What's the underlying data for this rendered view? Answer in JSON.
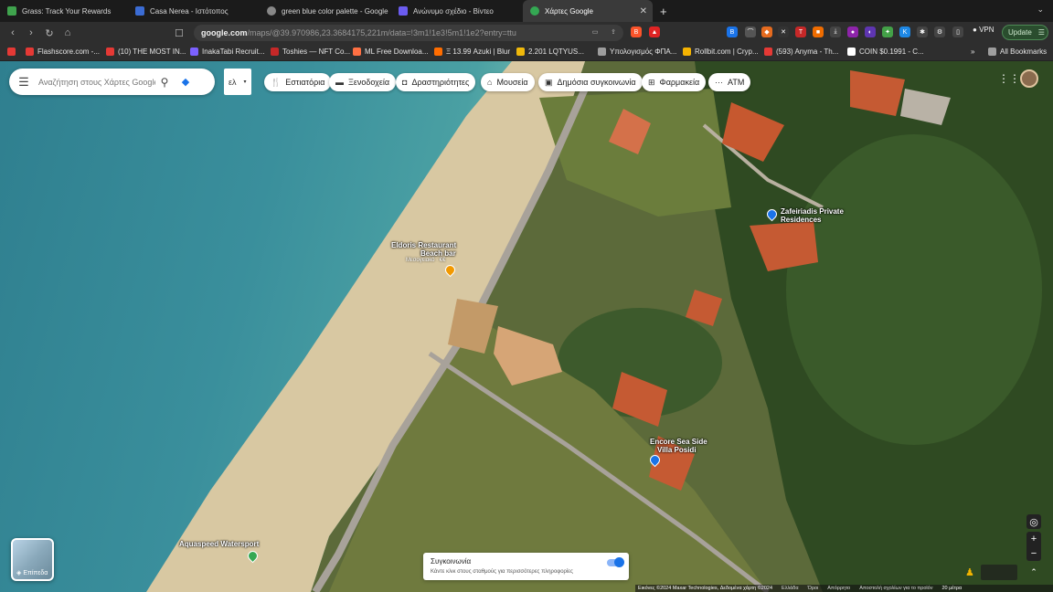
{
  "tabs": [
    {
      "label": "Grass: Track Your Rewards",
      "color": "#3fa34d"
    },
    {
      "label": "Casa Nerea - Ιστότοπος",
      "color": "#3b6cd4"
    },
    {
      "label": "green blue color palette - Google",
      "color": "#888888"
    },
    {
      "label": "Ανώνυμο σχέδιο - Βίντεο",
      "color": "#6b5cf0"
    },
    {
      "label": "Χάρτες Google",
      "color": "#34a853"
    }
  ],
  "nav": {
    "back": "‹",
    "forward": "›",
    "reload": "↻",
    "home": "⌂"
  },
  "omnibox": {
    "host": "google.com",
    "path": "/maps/@39.970986,23.3684175,221m/data=!3m1!1e3!5m1!1e2?entry=ttu"
  },
  "toolbar": {
    "vpn": "VPN",
    "update": "Update"
  },
  "bookmarks": [
    {
      "label": "Flashscore.com -...",
      "color": "#e53935"
    },
    {
      "label": "(10) THE MOST IN...",
      "color": "#e53935"
    },
    {
      "label": "InakaTabi Recruit...",
      "color": "#7b61ff"
    },
    {
      "label": "Toshies — NFT Co...",
      "color": "#c62828"
    },
    {
      "label": "ML Free Downloa...",
      "color": "#ff7043"
    },
    {
      "label": "Ξ 13.99 Azuki | Blur",
      "color": "#ff6d00"
    },
    {
      "label": "2.201 LQTYUS...",
      "color": "#f0b90b"
    },
    {
      "label": "Υπολογισμός ΦΠΑ...",
      "color": "#9e9e9e"
    },
    {
      "label": "Rollbit.com | Cryp...",
      "color": "#f5b301"
    },
    {
      "label": "(593) Anyma - Th...",
      "color": "#e53935"
    },
    {
      "label": "COIN $0.1991 - C...",
      "color": "#ffffff"
    }
  ],
  "all_bookmarks": "All Bookmarks",
  "search": {
    "placeholder": "Αναζήτηση στους Χάρτες Google"
  },
  "lang": "ελ",
  "chips": [
    {
      "label": "Εστιατόρια",
      "icon": "fork-knife-icon"
    },
    {
      "label": "Ξενοδοχεία",
      "icon": "bed-icon"
    },
    {
      "label": "Δραστηριότητες",
      "icon": "camera-icon"
    },
    {
      "label": "Μουσεία",
      "icon": "museum-icon"
    },
    {
      "label": "Δημόσια συγκοινωνία",
      "icon": "transit-icon"
    },
    {
      "label": "Φαρμακεία",
      "icon": "pharmacy-icon"
    },
    {
      "label": "ATM",
      "icon": "more-icon"
    }
  ],
  "places": {
    "zafeiriadis_1": "Zafeiriadis Private",
    "zafeiriadis_2": "Residences",
    "eldoris_1": "Eldoris Restaurant",
    "eldoris_2": "Beach bar",
    "eldoris_sub": "Μεσογειακό · €€",
    "encore_1": "Encore Sea Side",
    "encore_2": "Villa Posidi",
    "aquaspeed": "Aquaspeed Watersport"
  },
  "layers_label": "Επίπεδα",
  "transit_panel": {
    "title": "Συγκοινωνία",
    "text": "Κάντε κλικ στους σταθμούς για περισσότερες πληροφορίες"
  },
  "footer": {
    "imagery": "Εικόνες ©2024 Maxar Technologies, Δεδομένα χάρτη ©2024",
    "country": "Ελλάδα",
    "terms": "Όροι",
    "privacy": "Απόρρητο",
    "feedback": "Αποστολή σχολίων για το προϊόν",
    "scale": "20 μέτρα"
  }
}
